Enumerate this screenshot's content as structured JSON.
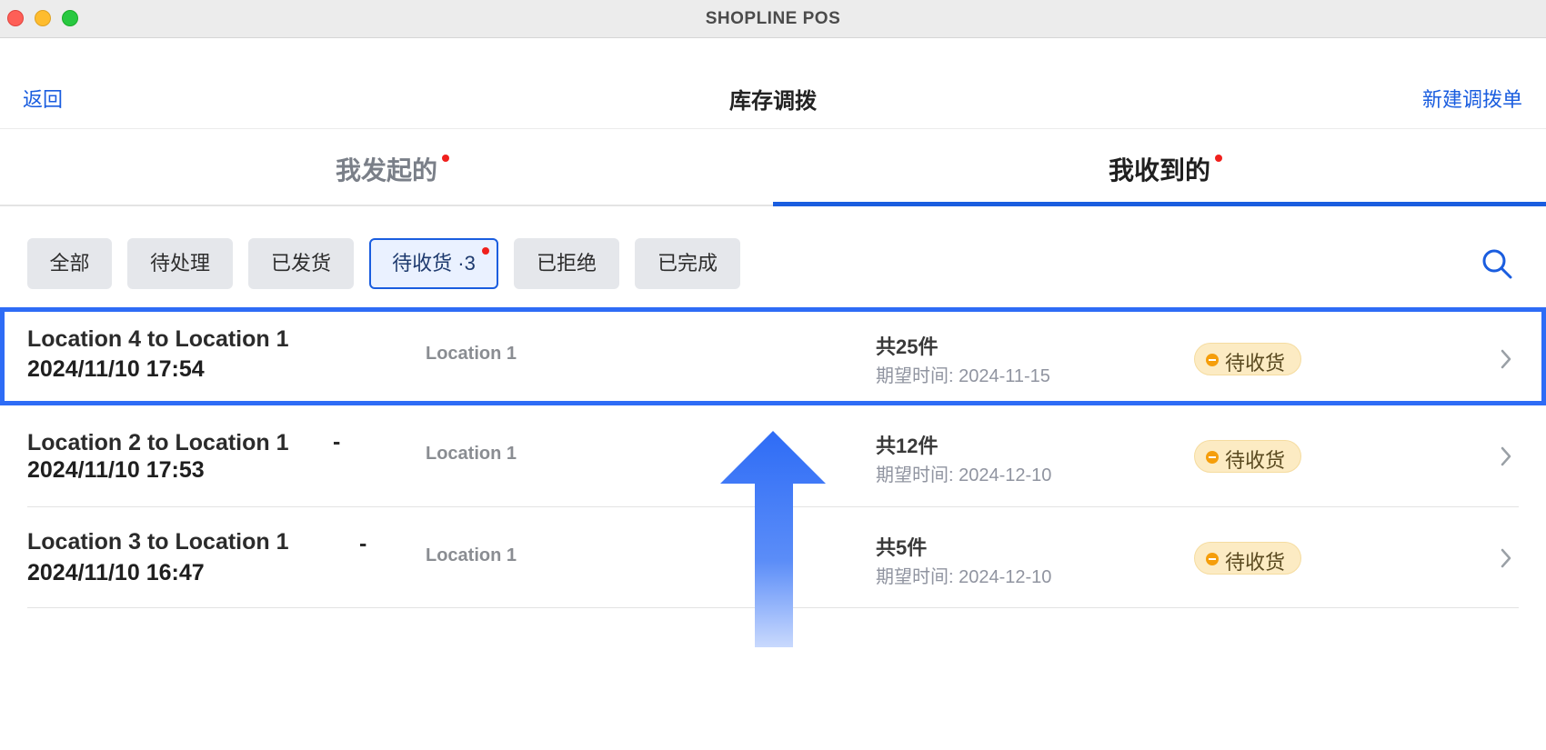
{
  "window": {
    "title": "SHOPLINE POS"
  },
  "header": {
    "back_label": "返回",
    "title": "库存调拨",
    "new_label": "新建调拨单"
  },
  "tabs": [
    {
      "label": "我发起的",
      "has_dot": true,
      "active": false
    },
    {
      "label": "我收到的",
      "has_dot": true,
      "active": true
    }
  ],
  "filters": [
    {
      "label": "全部"
    },
    {
      "label": "待处理"
    },
    {
      "label": "已发货"
    },
    {
      "label": "待收货 ·3",
      "active": true,
      "has_dot": true
    },
    {
      "label": "已拒绝"
    },
    {
      "label": "已完成"
    }
  ],
  "search": {
    "icon": "search-icon"
  },
  "rows": [
    {
      "title": "Location 4 to Location 1",
      "date": "2024/11/10 17:54",
      "dash": "",
      "location": "Location 1",
      "qty": "共25件",
      "expected": "期望时间: 2024-11-15",
      "status": "待收货",
      "selected": true
    },
    {
      "title": "Location 2 to Location 1",
      "date": "2024/11/10 17:53",
      "dash": "-",
      "location": "Location 1",
      "qty": "共12件",
      "expected": "期望时间: 2024-12-10",
      "status": "待收货",
      "selected": false
    },
    {
      "title": "Location 3 to Location 1",
      "date": "2024/11/10 16:47",
      "dash": "-",
      "location": "Location 1",
      "qty": "共5件",
      "expected": "期望时间: 2024-12-10",
      "status": "待收货",
      "selected": false
    }
  ],
  "colors": {
    "accent": "#1a5ddf",
    "badge_bg": "#fcebc3",
    "badge_dot": "#f59e0b",
    "dot_red": "#f0201d",
    "selection_border": "#2e6cf6"
  }
}
